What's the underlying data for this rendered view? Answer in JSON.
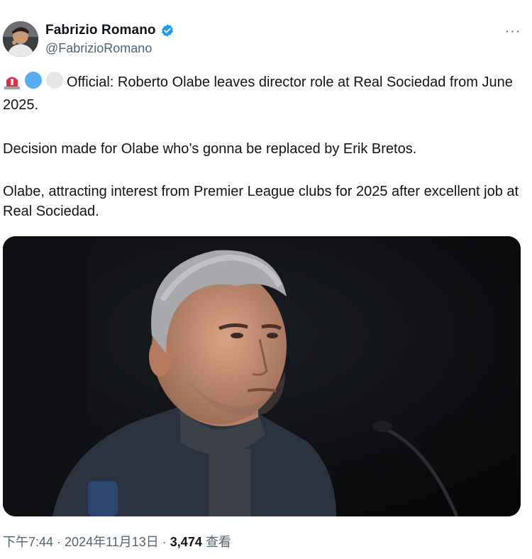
{
  "author": {
    "display_name": "Fabrizio Romano",
    "handle": "@FabrizioRomano",
    "verified_icon": "verified-badge-icon",
    "avatar_icon": "avatar-photo"
  },
  "menu": {
    "icon": "more-options-icon",
    "label": "···"
  },
  "tweet": {
    "emojis": [
      "rotating-light-emoji",
      "blue-circle-emoji",
      "white-circle-emoji"
    ],
    "paragraph1": "Official: Roberto Olabe leaves director role at Real Sociedad from June 2025.",
    "paragraph2": "Decision made for Olabe who’s gonna be replaced by Erik Bretos.",
    "paragraph3": "Olabe, attracting interest from Premier League clubs for 2025 after excellent job at Real Sociedad."
  },
  "media": {
    "description": "photo-man-at-press-conference"
  },
  "footer": {
    "time": "下午7:44",
    "separator": " · ",
    "date": "2024年11月13日",
    "views_count": "3,474",
    "views_label": "查看"
  },
  "colors": {
    "text": "#0f1419",
    "secondary": "#536471",
    "verified": "#1d9bf0"
  }
}
